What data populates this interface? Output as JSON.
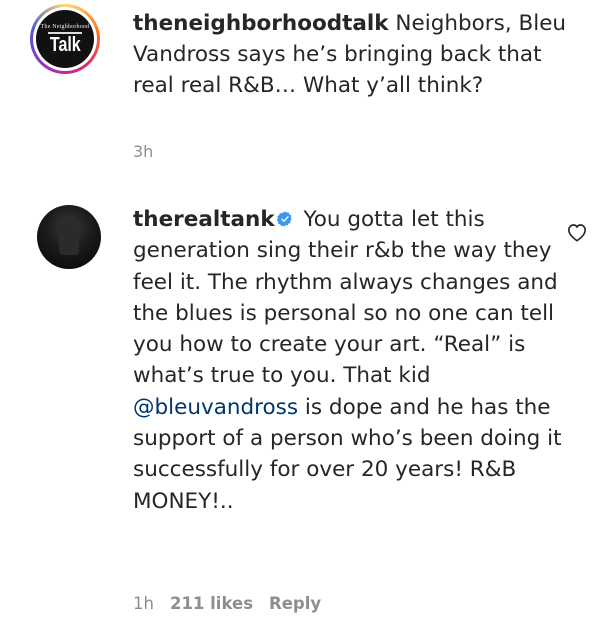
{
  "post": {
    "author": {
      "username": "theneighborhoodtalk",
      "avatar_logo_small": "The Neighborhood",
      "avatar_logo_big": "Talk"
    },
    "caption_text": " Neighbors, Bleu Vandross says he’s bringing back that real real R&B… What y’all think?",
    "time": "3h"
  },
  "comment": {
    "username": "therealtank",
    "verified_icon": "verified-badge-icon",
    "text_before_mention": " You gotta let this generation sing their r&b the way they feel it. The rhythm always changes and the blues is personal so no one can tell you how to create your art. “Real” is what’s true to you. That kid ",
    "mention": "@bleuvandross",
    "text_after_mention": " is dope and he has the support of a person who’s been doing it successfully for over 20 years! R&B MONEY!..",
    "time": "1h",
    "likes": "211 likes",
    "reply_label": "Reply",
    "like_icon": "heart-icon"
  },
  "colors": {
    "text": "#262626",
    "muted": "#8e8e8e",
    "mention": "#00376b",
    "verified": "#3897f0"
  }
}
